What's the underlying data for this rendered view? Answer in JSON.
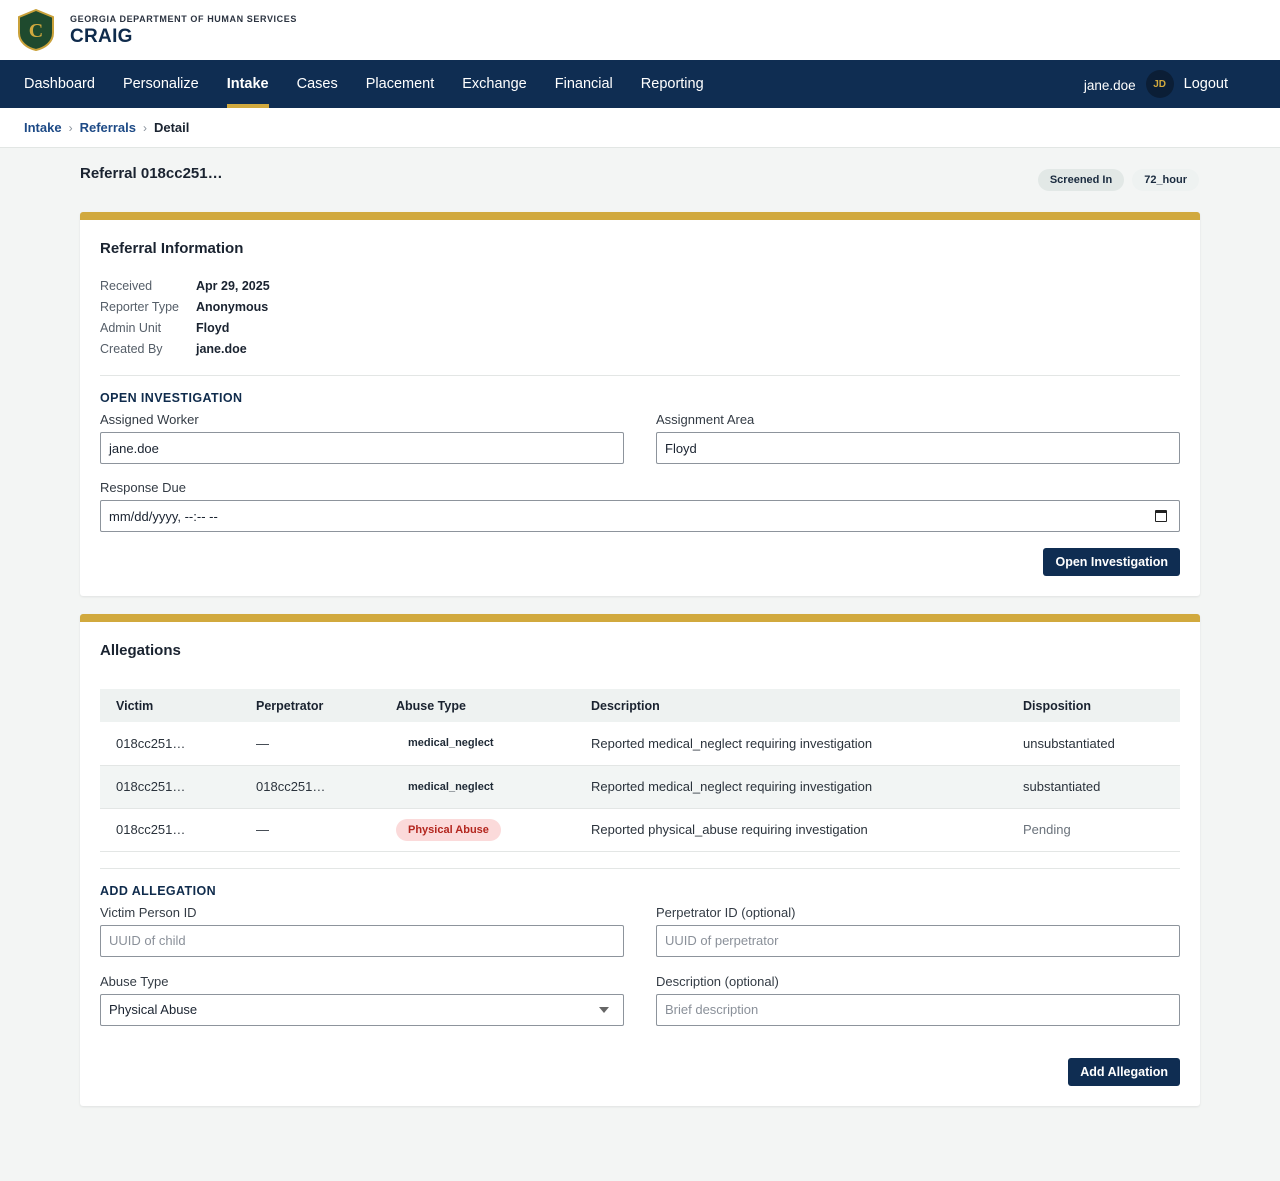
{
  "header": {
    "seal_letter": "C",
    "org_name": "GEORGIA DEPARTMENT OF HUMAN SERVICES",
    "app_name": "CRAIG"
  },
  "nav": {
    "items": [
      "Dashboard",
      "Personalize",
      "Intake",
      "Cases",
      "Placement",
      "Exchange",
      "Financial",
      "Reporting"
    ],
    "active": "Intake",
    "user": "jane.doe",
    "avatar_initials": "JD",
    "logout_label": "Logout"
  },
  "breadcrumb": {
    "items": [
      "Intake",
      "Referrals"
    ],
    "current": "Detail"
  },
  "page": {
    "title": "Referral 018cc251…",
    "badges": [
      "Screened In",
      "72_hour"
    ]
  },
  "referral_info": {
    "title": "Referral Information",
    "rows": [
      {
        "label": "Received",
        "value": "Apr 29, 2025"
      },
      {
        "label": "Reporter Type",
        "value": "Anonymous"
      },
      {
        "label": "Admin Unit",
        "value": "Floyd"
      },
      {
        "label": "Created By",
        "value": "jane.doe"
      }
    ]
  },
  "open_investigation": {
    "heading": "OPEN INVESTIGATION",
    "assigned_worker_label": "Assigned Worker",
    "assigned_worker_value": "jane.doe",
    "assignment_area_label": "Assignment Area",
    "assignment_area_value": "Floyd",
    "response_due_label": "Response Due",
    "response_due_placeholder": "mm/dd/yyyy, --:-- --",
    "button_label": "Open Investigation"
  },
  "allegations": {
    "title": "Allegations",
    "columns": [
      "Victim",
      "Perpetrator",
      "Abuse Type",
      "Description",
      "Disposition"
    ],
    "rows": [
      {
        "victim": "018cc251…",
        "perpetrator": "—",
        "abuse_type": "medical_neglect",
        "description": "Reported medical_neglect requiring investigation",
        "disposition": "unsubstantiated"
      },
      {
        "victim": "018cc251…",
        "perpetrator": "018cc251…",
        "abuse_type": "medical_neglect",
        "description": "Reported medical_neglect requiring investigation",
        "disposition": "substantiated"
      },
      {
        "victim": "018cc251…",
        "perpetrator": "—",
        "abuse_type": "Physical Abuse",
        "description": "Reported physical_abuse requiring investigation",
        "disposition": "Pending"
      }
    ]
  },
  "add_allegation": {
    "heading": "ADD ALLEGATION",
    "victim_label": "Victim Person ID",
    "victim_placeholder": "UUID of child",
    "perp_label": "Perpetrator ID (optional)",
    "perp_placeholder": "UUID of perpetrator",
    "abuse_type_label": "Abuse Type",
    "abuse_type_value": "Physical Abuse",
    "description_label": "Description (optional)",
    "description_placeholder": "Brief description",
    "button_label": "Add Allegation"
  },
  "colors": {
    "navy": "#0f2d52",
    "gold": "#d1a93e",
    "red_text": "#b3261e",
    "red_bg": "#fbdada"
  }
}
